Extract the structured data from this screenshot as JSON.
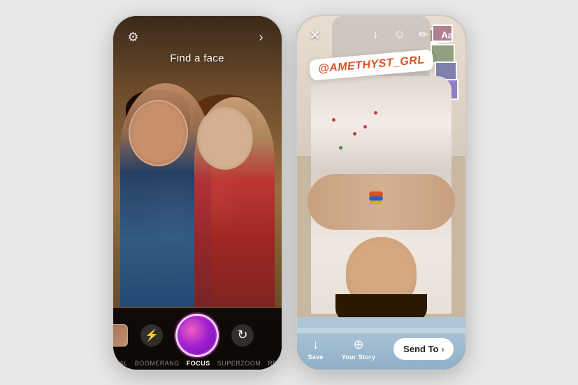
{
  "left_phone": {
    "find_face_text": "Find a face",
    "settings_icon": "⚙",
    "arrow_icon": "›",
    "modes": [
      {
        "label": "NORMAL",
        "active": false
      },
      {
        "label": "BOOMERANG",
        "active": false
      },
      {
        "label": "FOCUS",
        "active": true
      },
      {
        "label": "SUPERZOOM",
        "active": false
      },
      {
        "label": "REWIND",
        "active": false
      }
    ],
    "flash_icon": "⚡",
    "rotate_icon": "↻"
  },
  "right_phone": {
    "close_icon": "✕",
    "download_icon": "↓",
    "sticker_icon": "☺",
    "draw_icon": "✏",
    "aa_label": "Aa",
    "tag_text": "@AMETHYST_GRL",
    "save_label": "Save",
    "your_story_label": "Your Story",
    "send_to_label": "Send To",
    "send_chevron": "›"
  },
  "colors": {
    "accent": "#e040a0",
    "tag_color": "#e05020",
    "send_to_bg": "#ffffff"
  }
}
